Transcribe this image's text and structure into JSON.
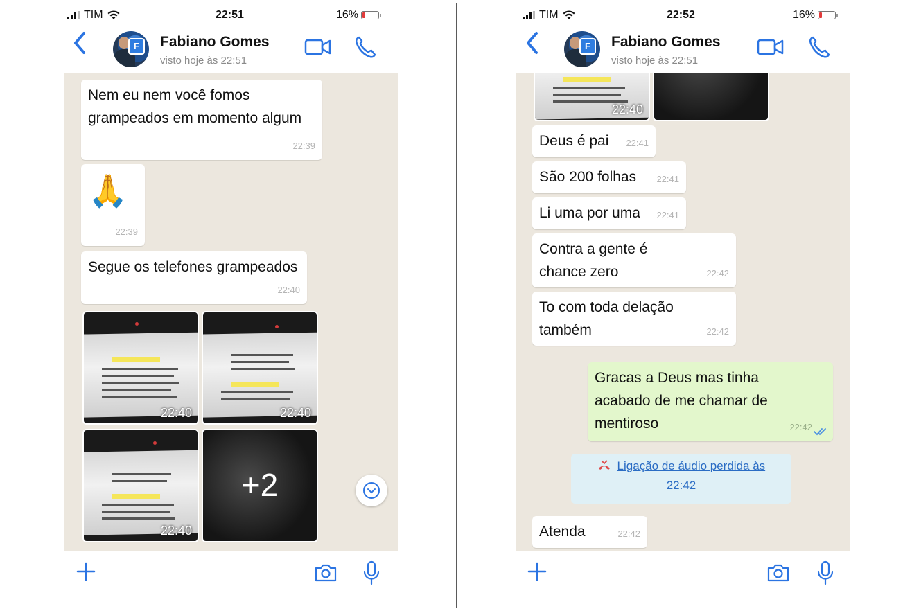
{
  "left": {
    "status": {
      "carrier": "TIM",
      "time": "22:51",
      "battery": "16%",
      "battery_level": 0.16
    },
    "header": {
      "name": "Fabiano Gomes",
      "seen": "visto hoje às 22:51"
    },
    "messages": [
      {
        "text": "Nem eu nem você fomos grampeados em momento algum",
        "time": "22:39"
      },
      {
        "text": "🙏",
        "time": "22:39"
      },
      {
        "text": "Segue os telefones grampeados",
        "time": "22:40"
      }
    ],
    "images": [
      {
        "time": "22:40"
      },
      {
        "time": "22:40"
      },
      {
        "time": "22:40"
      },
      {
        "more": "+2"
      }
    ]
  },
  "right": {
    "status": {
      "carrier": "TIM",
      "time": "22:52",
      "battery": "16%",
      "battery_level": 0.16
    },
    "header": {
      "name": "Fabiano Gomes",
      "seen": "visto hoje às 22:51"
    },
    "top_image_time": "22:40",
    "messages": [
      {
        "text": "Deus é pai",
        "time": "22:41"
      },
      {
        "text": "São 200 folhas",
        "time": "22:41"
      },
      {
        "text": "Li uma por uma",
        "time": "22:41"
      },
      {
        "text": "Contra a gente é chance zero",
        "time": "22:42"
      },
      {
        "text": "To com toda delação também",
        "time": "22:42"
      },
      {
        "text": "Gracas a Deus mas tinha acabado de me chamar de mentiroso",
        "time": "22:42",
        "outgoing": true
      },
      {
        "text": "Atenda",
        "time": "22:42"
      }
    ],
    "missed_call": {
      "line1": "Ligação de áudio perdida às",
      "line2": "22:42"
    }
  },
  "colors": {
    "accent": "#2b74e2",
    "chat_bg": "#ece7de",
    "outgoing": "#e3f7cc",
    "missed_call_bg": "#dff0f6"
  },
  "icons": [
    "back-icon",
    "video-call-icon",
    "phone-icon",
    "plus-icon",
    "camera-icon",
    "microphone-icon",
    "chevron-down-icon",
    "double-check-icon",
    "missed-call-icon"
  ]
}
